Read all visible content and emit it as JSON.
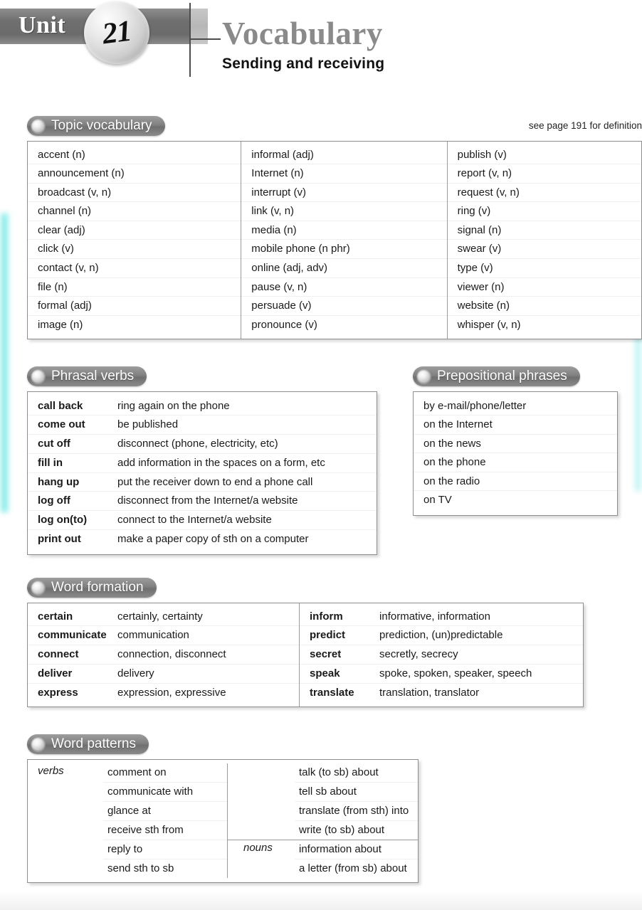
{
  "header": {
    "unit_label": "Unit",
    "unit_number": "21",
    "title": "Vocabulary",
    "subtitle": "Sending and receiving"
  },
  "topic_vocabulary": {
    "heading": "Topic vocabulary",
    "note": "see page 191 for definition",
    "columns": [
      [
        "accent (n)",
        "announcement (n)",
        "broadcast (v, n)",
        "channel (n)",
        "clear (adj)",
        "click (v)",
        "contact (v, n)",
        "file (n)",
        "formal (adj)",
        "image (n)"
      ],
      [
        "informal (adj)",
        "Internet (n)",
        "interrupt (v)",
        "link (v, n)",
        "media (n)",
        "mobile phone (n phr)",
        "online (adj, adv)",
        "pause (v, n)",
        "persuade (v)",
        "pronounce (v)"
      ],
      [
        "publish (v)",
        "report (v, n)",
        "request (v, n)",
        "ring (v)",
        "signal (n)",
        "swear (v)",
        "type (v)",
        "viewer (n)",
        "website (n)",
        "whisper (v, n)"
      ]
    ]
  },
  "phrasal_verbs": {
    "heading": "Phrasal verbs",
    "rows": [
      {
        "term": "call back",
        "definition": "ring again on the phone"
      },
      {
        "term": "come out",
        "definition": "be published"
      },
      {
        "term": "cut off",
        "definition": "disconnect (phone, electricity, etc)"
      },
      {
        "term": "fill in",
        "definition": "add information in the spaces on a form, etc"
      },
      {
        "term": "hang up",
        "definition": "put the receiver down to end a phone call"
      },
      {
        "term": "log off",
        "definition": "disconnect from the Internet/a website"
      },
      {
        "term": "log on(to)",
        "definition": "connect to the Internet/a website"
      },
      {
        "term": "print out",
        "definition": "make a paper copy of sth on a computer"
      }
    ]
  },
  "prepositional_phrases": {
    "heading": "Prepositional phrases",
    "items": [
      "by e-mail/phone/letter",
      "on the Internet",
      "on the news",
      "on the phone",
      "on the radio",
      "on TV"
    ]
  },
  "word_formation": {
    "heading": "Word formation",
    "left": [
      {
        "term": "certain",
        "forms": "certainly, certainty"
      },
      {
        "term": "communicate",
        "forms": "communication"
      },
      {
        "term": "connect",
        "forms": "connection, disconnect"
      },
      {
        "term": "deliver",
        "forms": "delivery"
      },
      {
        "term": "express",
        "forms": "expression, expressive"
      }
    ],
    "right": [
      {
        "term": "inform",
        "forms": "informative, information"
      },
      {
        "term": "predict",
        "forms": "prediction, (un)predictable"
      },
      {
        "term": "secret",
        "forms": "secretly, secrecy"
      },
      {
        "term": "speak",
        "forms": "spoke, spoken, speaker, speech"
      },
      {
        "term": "translate",
        "forms": "translation, translator"
      }
    ]
  },
  "word_patterns": {
    "heading": "Word patterns",
    "left": {
      "tag": "verbs",
      "items": [
        "comment on",
        "communicate with",
        "glance at",
        "receive sth from",
        "reply to",
        "send sth to sb"
      ]
    },
    "right_verbs": {
      "tag": "",
      "items": [
        "talk (to sb) about",
        "tell sb about",
        "translate (from sth) into",
        "write (to sb) about"
      ]
    },
    "right_nouns": {
      "tag": "nouns",
      "items": [
        "information about",
        "a letter (from sb) about"
      ]
    }
  }
}
